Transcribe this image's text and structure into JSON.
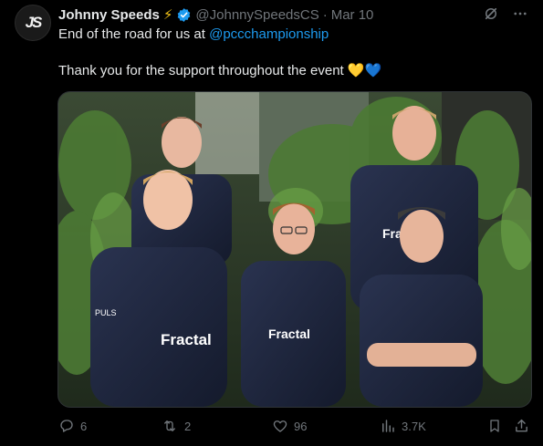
{
  "tweet": {
    "author_name": "Johnny Speeds",
    "handle": "@JohnnySpeedsCS",
    "separator": "·",
    "date": "Mar 10",
    "line1_prefix": "End of the road for us at ",
    "mention": "@pccchampionship",
    "line2": "Thank you for the support throughout the event",
    "avatar_text": "JS"
  },
  "media": {
    "jersey_brand": "Fractal",
    "sponsor": "PULS"
  },
  "actions": {
    "replies": "6",
    "reposts": "2",
    "likes": "96",
    "views": "3.7K"
  },
  "colors": {
    "accent": "#1d9bf0",
    "muted": "#71767b",
    "text": "#e7e9ea"
  }
}
